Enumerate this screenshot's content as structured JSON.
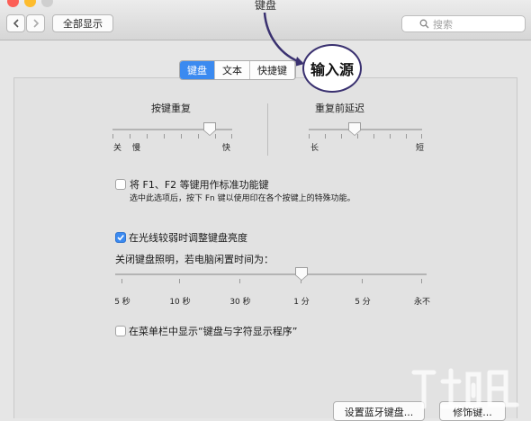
{
  "window": {
    "title": "键盘"
  },
  "toolbar": {
    "show_all": "全部显示",
    "search_placeholder": "搜索"
  },
  "tabs": [
    {
      "label": "键盘",
      "active": true
    },
    {
      "label": "文本",
      "active": false
    },
    {
      "label": "快捷键",
      "active": false
    }
  ],
  "annotation": {
    "label": "输入源"
  },
  "key_repeat": {
    "title": "按键重复",
    "min_label_1": "关",
    "min_label_2": "慢",
    "max_label": "快",
    "value_fraction": 0.8
  },
  "repeat_delay": {
    "title": "重复前延迟",
    "min_label": "长",
    "max_label": "短",
    "value_fraction": 0.4
  },
  "fn_keys": {
    "label": "将 F1、F2 等键用作标准功能键",
    "note": "选中此选项后，按下 Fn 键以使用印在各个按键上的特殊功能。",
    "checked": false
  },
  "brightness": {
    "label": "在光线较弱时调整键盘亮度",
    "checked": true
  },
  "idle": {
    "label": "关闭键盘照明，若电脑闲置时间为：",
    "ticks": [
      "5 秒",
      "10 秒",
      "30 秒",
      "1 分",
      "5 分",
      "永不"
    ],
    "value_index": 3
  },
  "menu_bar": {
    "label": "在菜单栏中显示“键盘与字符显示程序”",
    "checked": false
  },
  "buttons": {
    "bluetooth": "设置蓝牙键盘...",
    "modifier": "修饰键..."
  },
  "colors": {
    "accent": "#3b8af0",
    "annotation": "#3a3170"
  }
}
